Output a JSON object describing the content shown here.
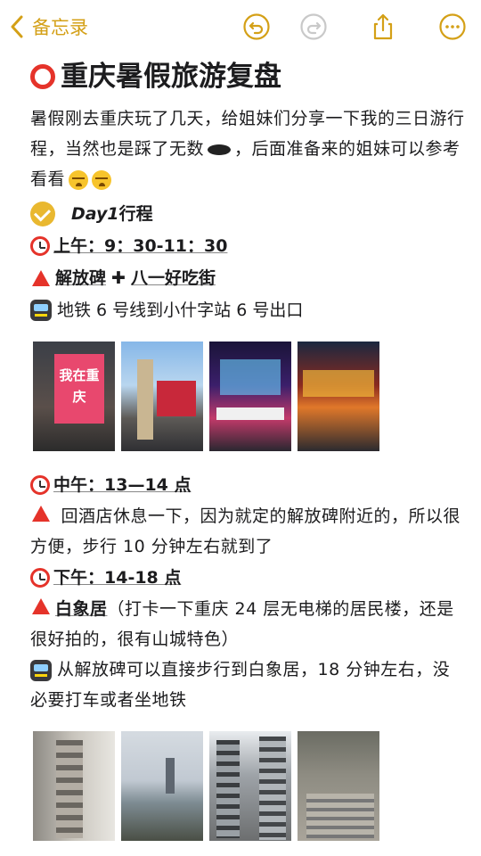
{
  "toolbar": {
    "back_label": "备忘录",
    "accent": "#d4a017"
  },
  "note": {
    "title": "重庆暑假旅游复盘",
    "intro_a": "暑假刚去重庆玩了几天，给姐妹们分享一下我的三日游行程，当然也是踩了无数",
    "intro_b": "，后面准备来的姐妹可以参考看看",
    "day1": "Day1",
    "day1_suffix": "行程",
    "morning_time": "上午：9：30-11：30",
    "morning_place_a": "解放碑",
    "morning_place_b": "八一好吃街",
    "morning_metro": "地铁 6 号线到小什字站 6 号出口",
    "noon_time": "中午：13—14 点",
    "noon_desc": "回酒店休息一下，因为就定的解放碑附近的，所以很方便，步行 10 分钟左右就到了",
    "afternoon_time": "下午：14-18 点",
    "afternoon_place": "白象居",
    "afternoon_desc": "（打卡一下重庆 24 层无电梯的居民楼，还是很好拍的，很有山城特色）",
    "afternoon_walk": "从解放碑可以直接步行到白象居，18 分钟左右，没必要打车或者坐地铁",
    "photo_sign_text": "我在重庆"
  },
  "icons": [
    "chevron-left-icon",
    "undo-icon",
    "redo-icon",
    "share-icon",
    "more-icon",
    "red-circle-icon",
    "check-circle-icon",
    "alarm-clock-icon",
    "red-triangle-icon",
    "metro-icon",
    "plus-icon",
    "hole-icon",
    "crying-face-icon"
  ]
}
